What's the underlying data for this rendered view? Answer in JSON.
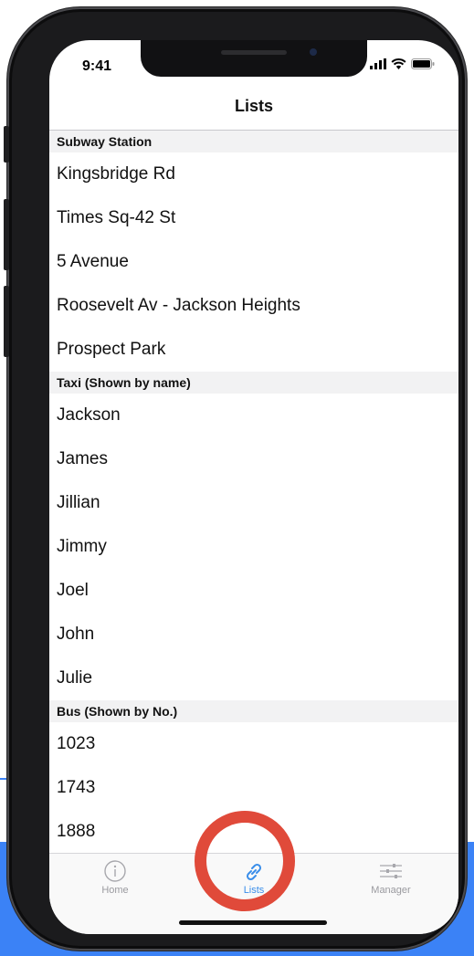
{
  "status_bar": {
    "time": "9:41"
  },
  "nav": {
    "title": "Lists"
  },
  "sections": [
    {
      "header": "Subway Station",
      "rows": [
        "Kingsbridge Rd",
        "Times Sq-42 St",
        "5 Avenue",
        "Roosevelt Av - Jackson Heights",
        "Prospect Park"
      ]
    },
    {
      "header": "Taxi (Shown by name)",
      "rows": [
        "Jackson",
        "James",
        "Jillian",
        "Jimmy",
        "Joel",
        "John",
        "Julie"
      ]
    },
    {
      "header": "Bus (Shown by No.)",
      "rows": [
        "1023",
        "1743",
        "1888"
      ]
    }
  ],
  "tabbar": {
    "tabs": [
      {
        "label": "Home",
        "icon": "info-icon"
      },
      {
        "label": "Lists",
        "icon": "link-icon",
        "active": true
      },
      {
        "label": "Manager",
        "icon": "sliders-icon"
      }
    ]
  },
  "colors": {
    "accent": "#3a8eea",
    "highlight_ring": "#e04a3a",
    "background_band": "#3b82f6"
  }
}
